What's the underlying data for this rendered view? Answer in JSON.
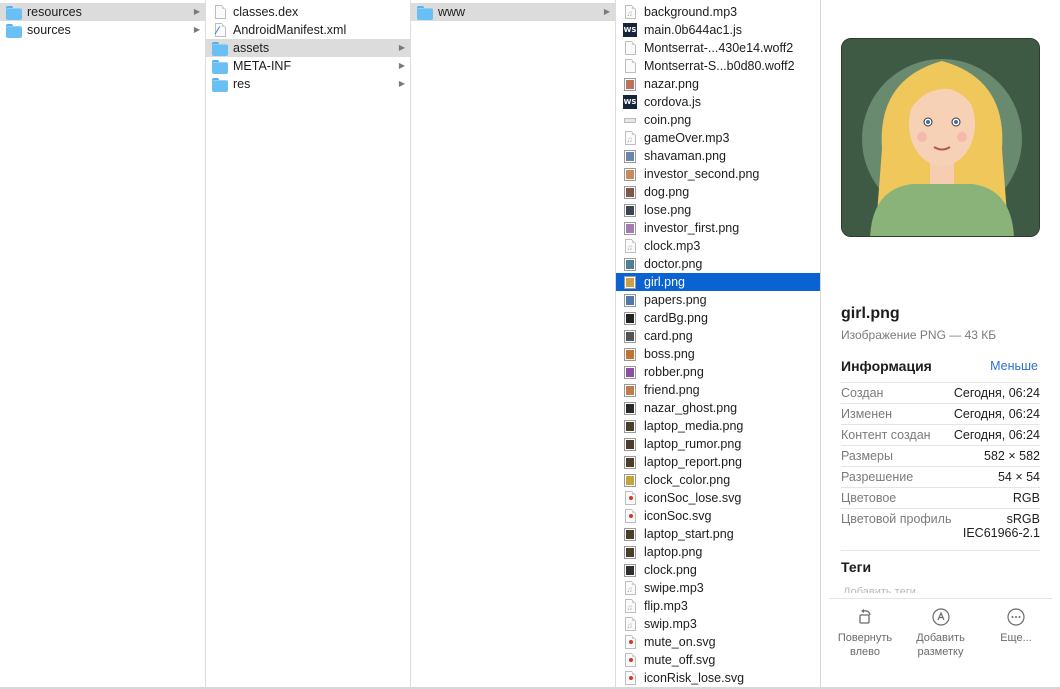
{
  "columns": [
    {
      "rows": [
        {
          "label": "resources",
          "icon": "folder",
          "arrow": true,
          "selected": true
        },
        {
          "label": "sources",
          "icon": "folder",
          "arrow": true
        }
      ]
    },
    {
      "rows": [
        {
          "label": "classes.dex",
          "icon": "doc"
        },
        {
          "label": "AndroidManifest.xml",
          "icon": "xml"
        },
        {
          "label": "assets",
          "icon": "folder",
          "arrow": true,
          "selected": true
        },
        {
          "label": "META-INF",
          "icon": "folder",
          "arrow": true
        },
        {
          "label": "res",
          "icon": "folder",
          "arrow": true
        }
      ]
    },
    {
      "rows": [
        {
          "label": "www",
          "icon": "folder",
          "arrow": true,
          "selected": true
        }
      ]
    },
    {
      "rows": [
        {
          "label": "background.mp3",
          "icon": "audio"
        },
        {
          "label": "main.0b644ac1.js",
          "icon": "ws"
        },
        {
          "label": "Montserrat-...430e14.woff2",
          "icon": "doc"
        },
        {
          "label": "Montserrat-S...b0d80.woff2",
          "icon": "doc"
        },
        {
          "label": "nazar.png",
          "icon": "img",
          "color": "#b9745a"
        },
        {
          "label": "cordova.js",
          "icon": "ws"
        },
        {
          "label": "coin.png",
          "icon": "line"
        },
        {
          "label": "gameOver.mp3",
          "icon": "audio"
        },
        {
          "label": "shavaman.png",
          "icon": "img",
          "color": "#6b86a8"
        },
        {
          "label": "investor_second.png",
          "icon": "img",
          "color": "#c98a5e"
        },
        {
          "label": "dog.png",
          "icon": "img",
          "color": "#7b5a4a"
        },
        {
          "label": "lose.png",
          "icon": "img",
          "color": "#3d4650"
        },
        {
          "label": "investor_first.png",
          "icon": "img",
          "color": "#a47bb0"
        },
        {
          "label": "clock.mp3",
          "icon": "audio"
        },
        {
          "label": "doctor.png",
          "icon": "img",
          "color": "#4f7f92"
        },
        {
          "label": "girl.png",
          "icon": "img",
          "color": "#c9a24a",
          "active": true
        },
        {
          "label": "papers.png",
          "icon": "img",
          "color": "#4f79a8"
        },
        {
          "label": "cardBg.png",
          "icon": "img",
          "color": "#222222"
        },
        {
          "label": "card.png",
          "icon": "img",
          "color": "#555555"
        },
        {
          "label": "boss.png",
          "icon": "img",
          "color": "#c6722f"
        },
        {
          "label": "robber.png",
          "icon": "img",
          "color": "#8b4fa3"
        },
        {
          "label": "friend.png",
          "icon": "img",
          "color": "#c27b4c"
        },
        {
          "label": "nazar_ghost.png",
          "icon": "img",
          "color": "#2a2a2a"
        },
        {
          "label": "laptop_media.png",
          "icon": "img",
          "color": "#4a3f2a"
        },
        {
          "label": "laptop_rumor.png",
          "icon": "img",
          "color": "#4a3f2a"
        },
        {
          "label": "laptop_report.png",
          "icon": "img",
          "color": "#4a3f2a"
        },
        {
          "label": "clock_color.png",
          "icon": "img",
          "color": "#c4a73b"
        },
        {
          "label": "iconSoc_lose.svg",
          "icon": "svg"
        },
        {
          "label": "iconSoc.svg",
          "icon": "svg"
        },
        {
          "label": "laptop_start.png",
          "icon": "img",
          "color": "#4a3f2a"
        },
        {
          "label": "laptop.png",
          "icon": "img",
          "color": "#4a3f2a"
        },
        {
          "label": "clock.png",
          "icon": "img",
          "color": "#2f2f2f"
        },
        {
          "label": "swipe.mp3",
          "icon": "audio"
        },
        {
          "label": "flip.mp3",
          "icon": "audio"
        },
        {
          "label": "swip.mp3",
          "icon": "audio"
        },
        {
          "label": "mute_on.svg",
          "icon": "svg"
        },
        {
          "label": "mute_off.svg",
          "icon": "svg"
        },
        {
          "label": "iconRisk_lose.svg",
          "icon": "svg"
        }
      ]
    }
  ],
  "preview": {
    "name": "girl.png",
    "kind": "Изображение PNG — 43 КБ",
    "info_title": "Информация",
    "less_label": "Меньше",
    "info": [
      {
        "k": "Создан",
        "v": "Сегодня, 06:24"
      },
      {
        "k": "Изменен",
        "v": "Сегодня, 06:24"
      },
      {
        "k": "Контент создан",
        "v": "Сегодня, 06:24"
      },
      {
        "k": "Размеры",
        "v": "582 × 582"
      },
      {
        "k": "Разрешение",
        "v": "54 × 54"
      },
      {
        "k": "Цветовое",
        "v": "RGB"
      },
      {
        "k": "Цветовой профиль",
        "v": "sRGB IEC61966-2.1"
      }
    ],
    "tags_title": "Теги",
    "tags_placeholder": "Добавить теги",
    "actions": [
      {
        "name": "rotate-left",
        "label": "Повернуть влево"
      },
      {
        "name": "markup",
        "label": "Добавить разметку"
      },
      {
        "name": "more",
        "label": "Еще..."
      }
    ]
  },
  "colors": {
    "selection": "#0a63d1",
    "folder": "#6ac0f5",
    "link": "#2b6fd5",
    "preview_bg": "#3f5a44"
  }
}
